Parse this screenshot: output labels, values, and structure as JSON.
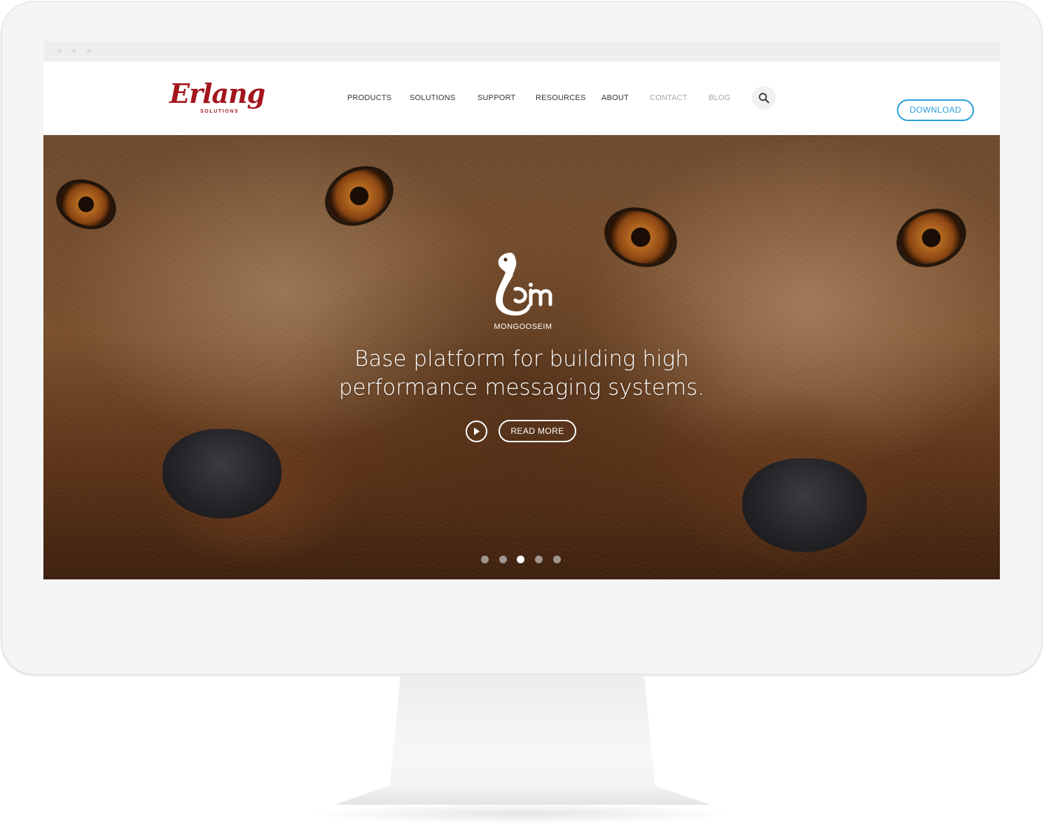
{
  "site": {
    "logo": {
      "wordmark": "Erlang",
      "subtitle": "SOLUTIONS",
      "color": "#a3161e"
    },
    "nav": [
      {
        "label": "PRODUCTS",
        "state": "default"
      },
      {
        "label": "SOLUTIONS",
        "state": "default"
      },
      {
        "label": "SUPPORT",
        "state": "default"
      },
      {
        "label": "RESOURCES",
        "state": "default"
      },
      {
        "label": "ABOUT",
        "state": "default"
      },
      {
        "label": "CONTACT",
        "state": "muted"
      },
      {
        "label": "BLOG",
        "state": "muted"
      }
    ],
    "search_icon": "search-icon",
    "download_label": "DOWNLOAD",
    "accent_color": "#2aa0d8"
  },
  "hero": {
    "brand_name": "MONGOOSEIM",
    "headline_line1": "Base platform for building high",
    "headline_line2": "performance messaging systems.",
    "play_icon": "play-icon",
    "read_more_label": "READ MORE",
    "slides_total": 5,
    "active_slide": 3
  }
}
